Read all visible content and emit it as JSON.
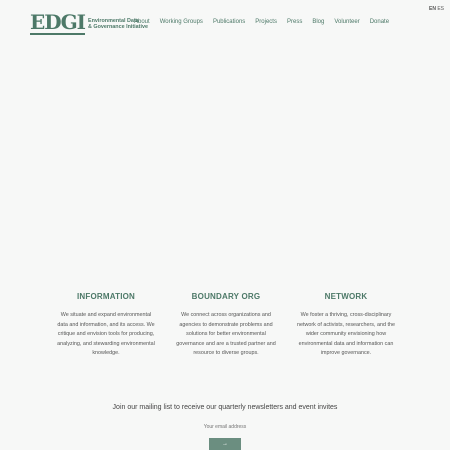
{
  "header": {
    "logo_mark": "EDGI",
    "logo_line1": "Environmental Data",
    "logo_line2": "& Governance Initiative",
    "nav": [
      "About",
      "Working Groups",
      "Publications",
      "Projects",
      "Press",
      "Blog",
      "Volunteer",
      "Donate"
    ],
    "lang_active": "EN",
    "lang_other": "ES"
  },
  "columns": [
    {
      "title": "INFORMATION",
      "text": "We situate and expand environmental data and information, and its access. We critique and envision tools for producing, analyzing, and stewarding environmental knowledge."
    },
    {
      "title": "BOUNDARY ORG",
      "text": "We connect across organizations and agencies to demonstrate problems and solutions for better environmental governance and are a trusted partner and resource to diverse groups."
    },
    {
      "title": "NETWORK",
      "text": "We foster a thriving, cross-disciplinary network of activists, researchers, and the wider community envisioning how environmental data and information can improve governance."
    }
  ],
  "mailing": {
    "heading": "Join our mailing list to receive our quarterly newsletters and event invites",
    "email_placeholder": "Your email address",
    "submit_label": "→"
  },
  "colors": {
    "brand_green": "#4d7968",
    "button_green": "#6b8e80",
    "background": "#f7f8f7"
  }
}
